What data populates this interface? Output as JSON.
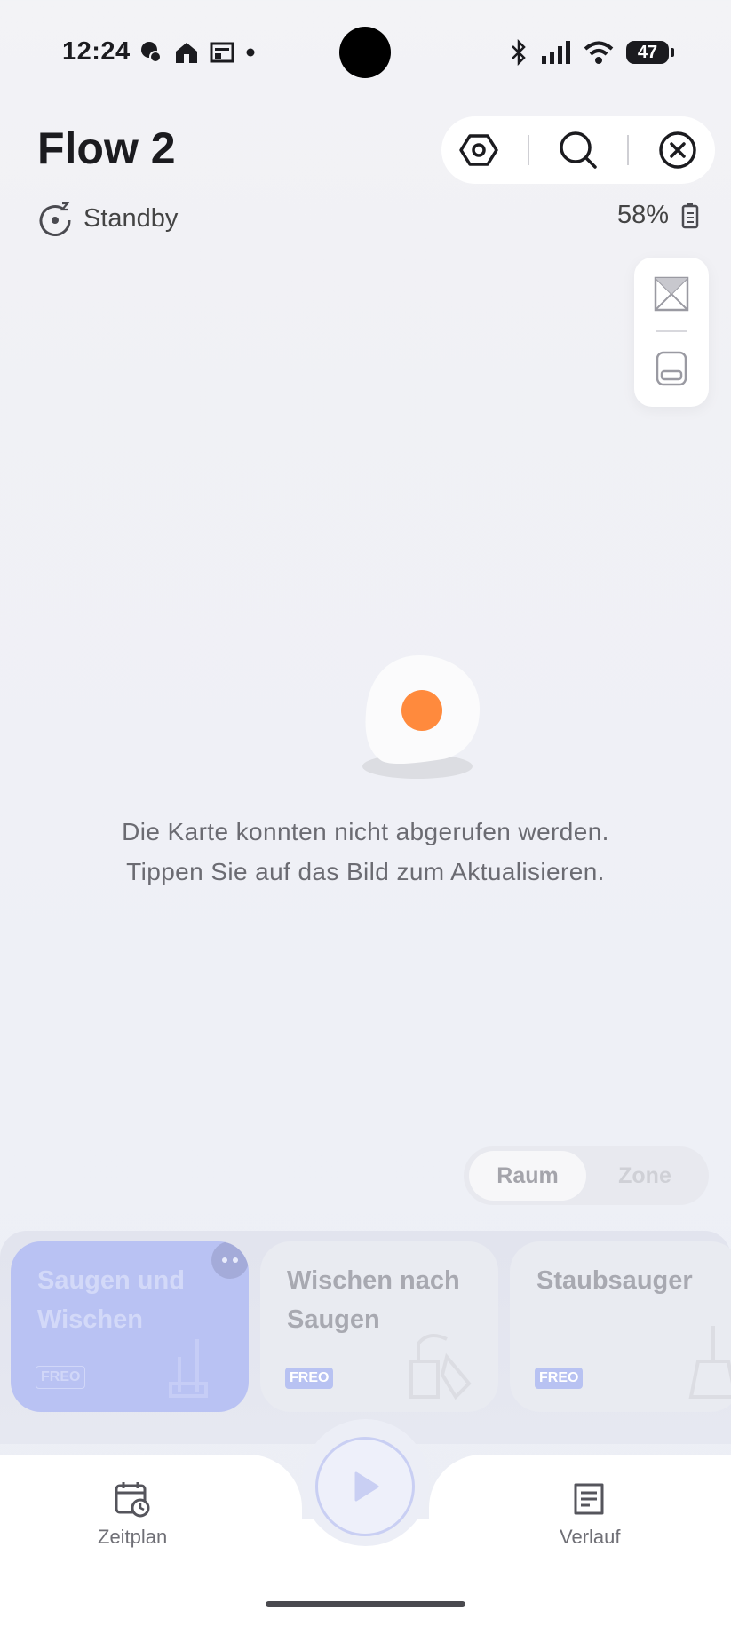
{
  "status_bar": {
    "time": "12:24",
    "battery": "47"
  },
  "header": {
    "title": "Flow 2",
    "status": "Standby",
    "battery_percent": "58%"
  },
  "map": {
    "error_line1": "Die Karte konnten nicht abgerufen werden.",
    "error_line2": "Tippen Sie auf das Bild zum Aktualisieren."
  },
  "segmented": {
    "options": [
      "Raum",
      "Zone"
    ],
    "selected": "Raum"
  },
  "modes": [
    {
      "label_line1": "Saugen und",
      "label_line2": "Wischen",
      "badge": "FREO",
      "selected": true
    },
    {
      "label_line1": "Wischen nach",
      "label_line2": "Saugen",
      "badge": "FREO",
      "selected": false
    },
    {
      "label_line1": "Staubsauger",
      "label_line2": "",
      "badge": "FREO",
      "selected": false
    }
  ],
  "bottom_nav": {
    "left_label": "Zeitplan",
    "right_label": "Verlauf"
  },
  "colors": {
    "accent": "#b9c2f3",
    "robot_dot": "#ff8a3d"
  }
}
